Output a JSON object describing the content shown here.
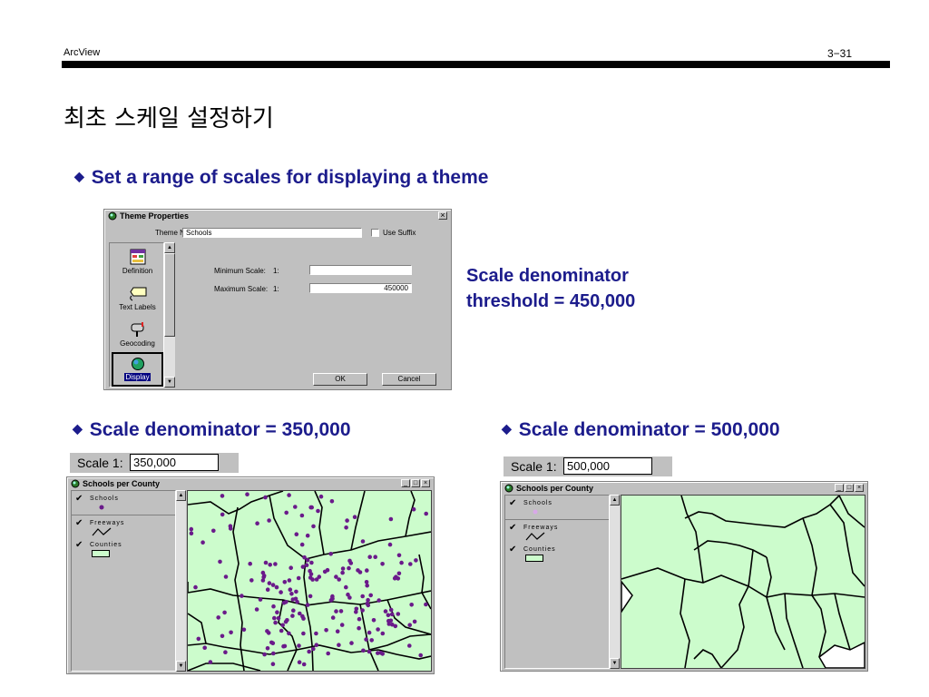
{
  "header": {
    "left": "ArcView",
    "right": "3−31"
  },
  "title": "최초 스케일 설정하기",
  "bullets": {
    "b1": "Set a range of scales for displaying a theme",
    "b2": "Scale denominator = 350,000",
    "b3": "Scale denominator = 500,000"
  },
  "note": {
    "line1": "Scale denominator",
    "line2": "threshold = 450,000"
  },
  "dialog": {
    "title": "Theme Properties",
    "theme_name_label": "Theme Name:",
    "theme_name_value": "Schools",
    "use_suffix": "Use Suffix",
    "sidebar": [
      "Definition",
      "Text Labels",
      "Geocoding",
      "Display"
    ],
    "min_scale_label": "Minimum Scale:",
    "max_scale_label": "Maximum Scale:",
    "scale_prefix": "1:",
    "min_scale_value": "",
    "max_scale_value": "450000",
    "ok": "OK",
    "cancel": "Cancel"
  },
  "left_view": {
    "scale_label": "Scale 1:",
    "scale_value": "350,000",
    "window_title": "Schools per County",
    "legend": [
      "Schools",
      "Freeways",
      "Counties"
    ]
  },
  "right_view": {
    "scale_label": "Scale 1:",
    "scale_value": "500,000",
    "window_title": "Schools per County",
    "legend": [
      "Schools",
      "Freeways",
      "Counties"
    ]
  },
  "colors": {
    "bullet": "#1c1c8c",
    "school_point": "#6a1a8a",
    "county_fill": "#ccfccc",
    "window_gray": "#c0c0c0"
  },
  "win_buttons": {
    "minimize": "_",
    "maximize": "□",
    "close": "×"
  }
}
